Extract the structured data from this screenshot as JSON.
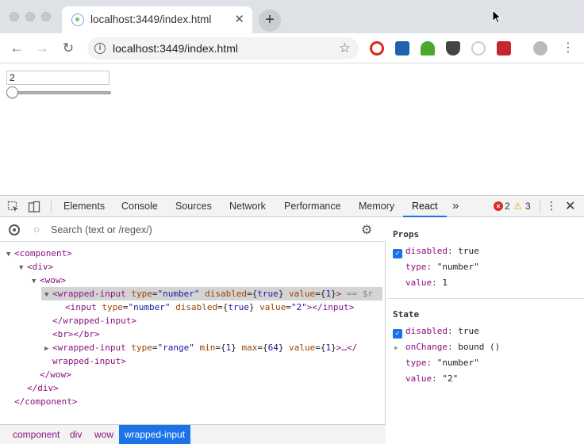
{
  "browser": {
    "tab_title": "localhost:3449/index.html",
    "tab_close_glyph": "✕",
    "new_tab_glyph": "+",
    "url": "localhost:3449/index.html",
    "back_glyph": "←",
    "forward_glyph": "→",
    "reload_glyph": "↻",
    "info_glyph": "i",
    "star_glyph": "☆",
    "menu_glyph": "⋮",
    "extension_icons": [
      "opera-icon",
      "k-extension-icon",
      "green-extension-icon",
      "pocket-icon",
      "grey-extension-icon",
      "red-extension-icon",
      "profile-avatar"
    ]
  },
  "page": {
    "number_value": "2",
    "range_min": 1,
    "range_max": 64,
    "range_value": 1
  },
  "devtools": {
    "tabs": [
      "Elements",
      "Console",
      "Sources",
      "Network",
      "Performance",
      "Memory",
      "React"
    ],
    "active_tab": "React",
    "more_glyph": "»",
    "error_glyph": "×",
    "error_count": "2",
    "warning_glyph": "⚠",
    "warning_count": "3",
    "kebab_glyph": "⋮",
    "close_glyph": "✕",
    "search_placeholder": "Search (text or /regex/)",
    "search_glyph": "○",
    "gear_glyph": "⚙",
    "tree": [
      {
        "indent": 0,
        "tri": "▼",
        "parts": [
          [
            "tag",
            "<component>"
          ]
        ]
      },
      {
        "indent": 1,
        "tri": "▼",
        "parts": [
          [
            "tag",
            "<div>"
          ]
        ]
      },
      {
        "indent": 2,
        "tri": "▼",
        "parts": [
          [
            "tag",
            "<wow>"
          ]
        ]
      },
      {
        "indent": 3,
        "tri": "▼",
        "selected": true,
        "parts": [
          [
            "tag",
            "<wrapped-input"
          ],
          [
            "jx",
            " "
          ],
          [
            "an",
            "type"
          ],
          [
            "jx",
            "="
          ],
          [
            "av",
            "\"number\""
          ],
          [
            "jx",
            " "
          ],
          [
            "an",
            "disabled"
          ],
          [
            "jx",
            "={"
          ],
          [
            "av",
            "true"
          ],
          [
            "jx",
            "}"
          ],
          [
            "jx",
            " "
          ],
          [
            "an",
            "value"
          ],
          [
            "jx",
            "={"
          ],
          [
            "av",
            "1"
          ],
          [
            "jx",
            "}"
          ],
          [
            "tag",
            ">"
          ],
          [
            "dim",
            " == $r"
          ]
        ]
      },
      {
        "indent": 4,
        "tri": "",
        "parts": [
          [
            "tag",
            "<input"
          ],
          [
            "jx",
            " "
          ],
          [
            "an",
            "type"
          ],
          [
            "jx",
            "="
          ],
          [
            "av",
            "\"number\""
          ],
          [
            "jx",
            " "
          ],
          [
            "an",
            "disabled"
          ],
          [
            "jx",
            "={"
          ],
          [
            "av",
            "true"
          ],
          [
            "jx",
            "}"
          ],
          [
            "jx",
            " "
          ],
          [
            "an",
            "value"
          ],
          [
            "jx",
            "="
          ],
          [
            "av",
            "\"2\""
          ],
          [
            "tag",
            "></input>"
          ]
        ]
      },
      {
        "indent": 3,
        "tri": "",
        "parts": [
          [
            "tag",
            "</wrapped-input>"
          ]
        ]
      },
      {
        "indent": 3,
        "tri": "",
        "parts": [
          [
            "tag",
            "<br></br>"
          ]
        ]
      },
      {
        "indent": 3,
        "tri": "▶",
        "parts": [
          [
            "tag",
            "<wrapped-input"
          ],
          [
            "jx",
            " "
          ],
          [
            "an",
            "type"
          ],
          [
            "jx",
            "="
          ],
          [
            "av",
            "\"range\""
          ],
          [
            "jx",
            " "
          ],
          [
            "an",
            "min"
          ],
          [
            "jx",
            "={"
          ],
          [
            "av",
            "1"
          ],
          [
            "jx",
            "}"
          ],
          [
            "jx",
            " "
          ],
          [
            "an",
            "max"
          ],
          [
            "jx",
            "={"
          ],
          [
            "av",
            "64"
          ],
          [
            "jx",
            "}"
          ],
          [
            "jx",
            " "
          ],
          [
            "an",
            "value"
          ],
          [
            "jx",
            "={"
          ],
          [
            "av",
            "1"
          ],
          [
            "jx",
            "}"
          ],
          [
            "tag",
            ">…</"
          ]
        ]
      },
      {
        "indent": 3,
        "tri": "",
        "parts": [
          [
            "tag",
            "wrapped-input>"
          ]
        ]
      },
      {
        "indent": 2,
        "tri": "",
        "parts": [
          [
            "tag",
            "</wow>"
          ]
        ]
      },
      {
        "indent": 1,
        "tri": "",
        "parts": [
          [
            "tag",
            "</div>"
          ]
        ]
      },
      {
        "indent": 0,
        "tri": "",
        "parts": [
          [
            "tag",
            "</component>"
          ]
        ]
      }
    ],
    "breadcrumbs": [
      "component",
      "div",
      "wow",
      "wrapped-input"
    ],
    "props_title": "Props",
    "props": [
      {
        "checkbox": true,
        "key": "disabled:",
        "value": "true"
      },
      {
        "key": "type:",
        "value": "\"number\""
      },
      {
        "key": "value:",
        "value": "1"
      }
    ],
    "state_title": "State",
    "state": [
      {
        "checkbox": true,
        "key": "disabled:",
        "value": "true"
      },
      {
        "tri": "▶",
        "key": "onChange:",
        "value": "bound ()"
      },
      {
        "key": "type:",
        "value": "\"number\""
      },
      {
        "key": "value:",
        "value": "\"2\""
      }
    ],
    "checkbox_glyph": "✓"
  },
  "colors": {
    "accent": "#1a73e8",
    "tag": "#881280",
    "attr_name": "#994500",
    "attr_value": "#1a1aa6",
    "error": "#d93025",
    "warning": "#e8a600"
  }
}
